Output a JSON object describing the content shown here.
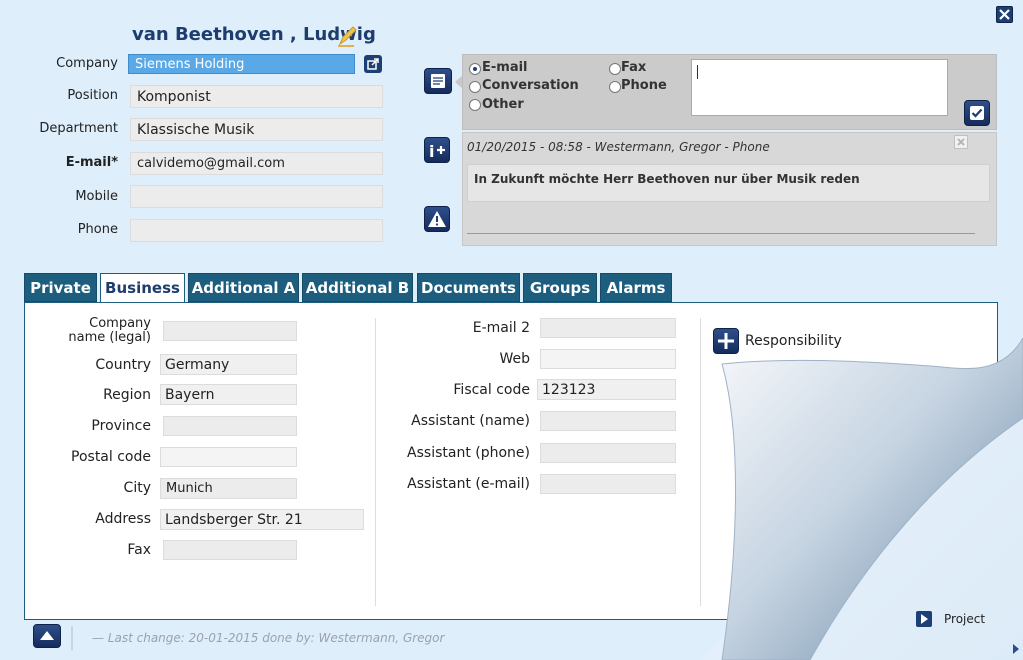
{
  "contact": {
    "name": "van Beethoven , Ludwig"
  },
  "left_fields": [
    {
      "label": "Company",
      "value": "Siemens Holding"
    },
    {
      "label": "Position",
      "value": "Komponist"
    },
    {
      "label": "Department",
      "value": "Klassische Musik"
    },
    {
      "label": "E-mail*",
      "value": "calvidemo@gmail.com"
    },
    {
      "label": "Mobile",
      "value": ""
    },
    {
      "label": "Phone",
      "value": ""
    }
  ],
  "comm": {
    "options": [
      "E-mail",
      "Conversation",
      "Other",
      "Fax",
      "Phone"
    ],
    "selected": "E-mail",
    "note_value": ""
  },
  "history": {
    "header": "01/20/2015 - 08:58 - Westermann, Gregor - Phone",
    "text": "In Zukunft möchte Herr Beethoven nur über Musik reden"
  },
  "tabs": [
    "Private",
    "Business",
    "Additional A",
    "Additional B",
    "Documents",
    "Groups",
    "Alarms"
  ],
  "active_tab": "Business",
  "business_left": [
    {
      "label": "Company name (legal)",
      "value": ""
    },
    {
      "label": "Country",
      "value": "Germany"
    },
    {
      "label": "Region",
      "value": "Bayern"
    },
    {
      "label": "Province",
      "value": ""
    },
    {
      "label": "Postal code",
      "value": ""
    },
    {
      "label": "City",
      "value": "Munich"
    },
    {
      "label": "Address",
      "value": "Landsberger Str. 21"
    },
    {
      "label": "Fax",
      "value": ""
    }
  ],
  "business_right": [
    {
      "label": "E-mail 2",
      "value": ""
    },
    {
      "label": "Web",
      "value": ""
    },
    {
      "label": "Fiscal code",
      "value": "123123"
    },
    {
      "label": "Assistant (name)",
      "value": ""
    },
    {
      "label": "Assistant (phone)",
      "value": ""
    },
    {
      "label": "Assistant (e-mail)",
      "value": ""
    }
  ],
  "responsibility_label": "Responsibility",
  "project_label": "Project",
  "footer": {
    "last_change": "— Last change: 20-01-2015 done by: Westermann, Gregor"
  },
  "colors": {
    "accent": "#1d5e7f",
    "company_highlight": "#5aa9e6",
    "background": "#dfeefb"
  }
}
